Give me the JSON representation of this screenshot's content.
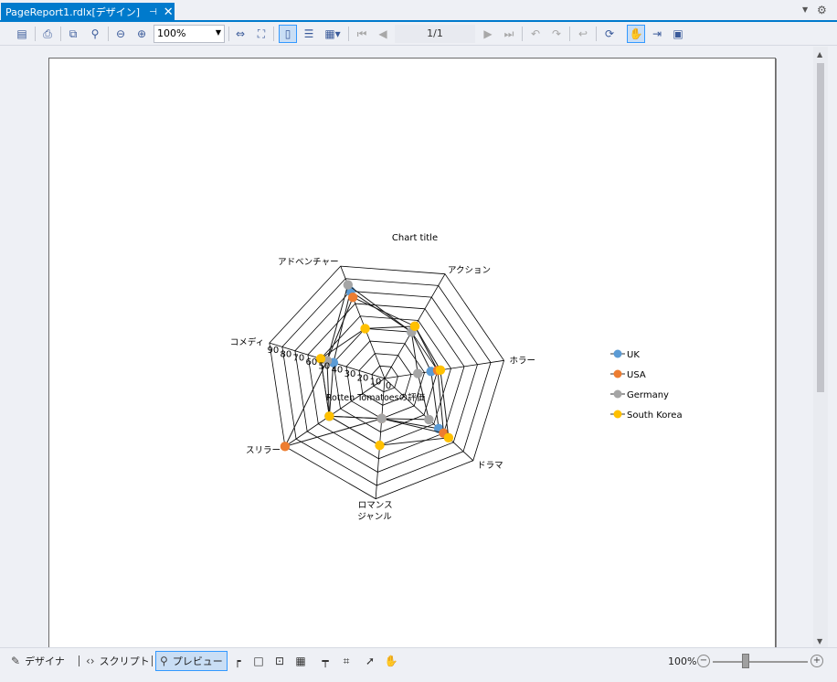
{
  "tab": {
    "title": "PageReport1.rdlx[デザイン]",
    "pin_icon": "pin-icon",
    "close_icon": "close-icon"
  },
  "toolbar": {
    "zoom_value": "100%",
    "page_indicator": "1/1"
  },
  "bottom_bar": {
    "designer_label": "デザイナ",
    "script_label": "スクリプト",
    "preview_label": "プレビュー",
    "zoom_percent": "100%"
  },
  "chart_data": {
    "type": "radar",
    "title": "Chart title",
    "categories": [
      "アクション",
      "ホラー",
      "ドラマ",
      "ロマンス",
      "スリラー",
      "コメディ",
      "アドベンチャー"
    ],
    "xlabel": "ジャンル",
    "ylabel": "Rotten Tomatoesの評価",
    "radial_ticks": [
      "90",
      "80",
      "70",
      "60",
      "50",
      "40",
      "30",
      "20",
      "10",
      "0"
    ],
    "rmax": 90,
    "series": [
      {
        "name": "UK",
        "color": "#5b9bd5",
        "values": [
          40,
          35,
          55,
          30,
          50,
          40,
          70
        ]
      },
      {
        "name": "USA",
        "color": "#ed7d31",
        "values": [
          45,
          40,
          60,
          30,
          90,
          45,
          65
        ]
      },
      {
        "name": "Germany",
        "color": "#a5a5a5",
        "values": [
          40,
          25,
          45,
          30,
          50,
          45,
          75
        ]
      },
      {
        "name": "South Korea",
        "color": "#ffc000",
        "values": [
          45,
          42,
          65,
          50,
          50,
          50,
          40
        ]
      }
    ],
    "legend": "right"
  }
}
